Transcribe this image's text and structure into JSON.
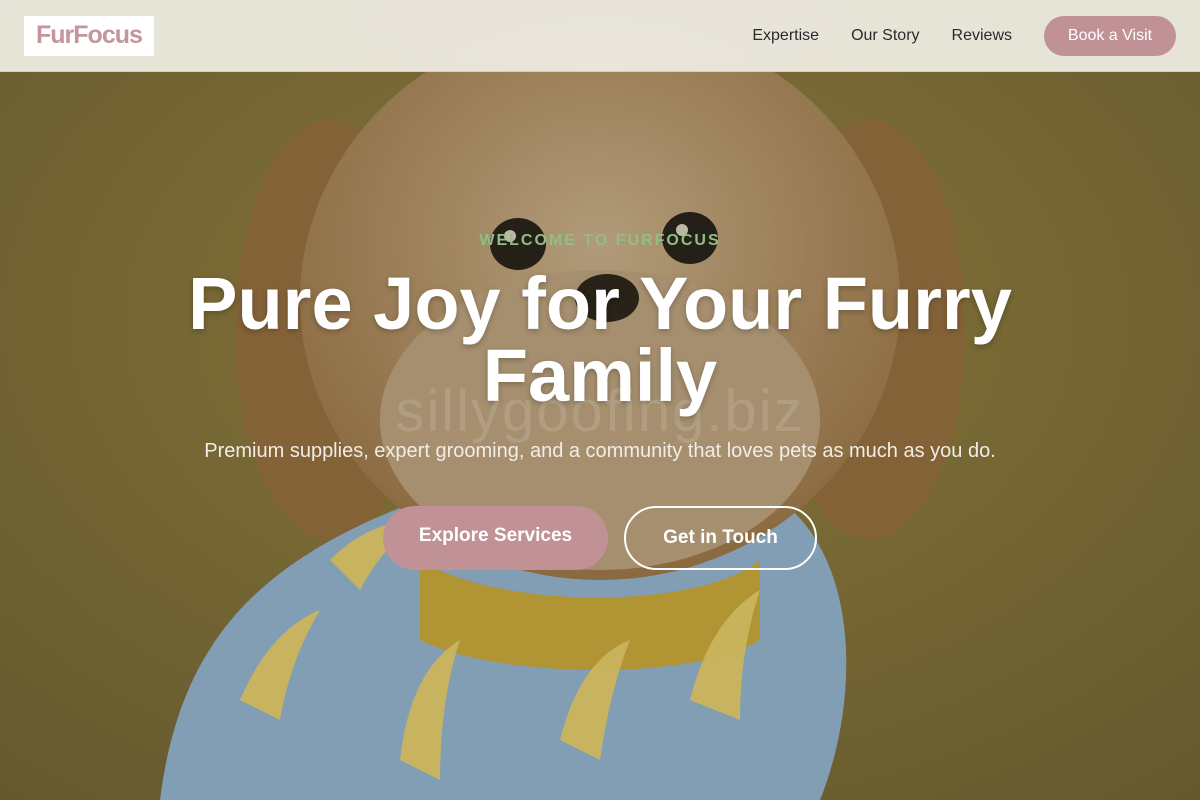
{
  "brand": {
    "logo_text": "FurFocus"
  },
  "nav": {
    "links": [
      {
        "label": "Expertise"
      },
      {
        "label": "Our Story"
      },
      {
        "label": "Reviews"
      }
    ],
    "cta_label": "Book a Visit"
  },
  "hero": {
    "eyebrow": "WELCOME TO FURFOCUS",
    "headline": "Pure Joy for Your Furry Family",
    "watermark": "sillygoofing.biz",
    "subhead": "Premium supplies, expert grooming, and a community that loves pets as much as you do.",
    "primary_button": "Explore Services",
    "secondary_button": "Get in Touch"
  },
  "colors": {
    "accent": "#c09195",
    "eyebrow": "#8fbf86",
    "background": "#7a6c3c"
  }
}
